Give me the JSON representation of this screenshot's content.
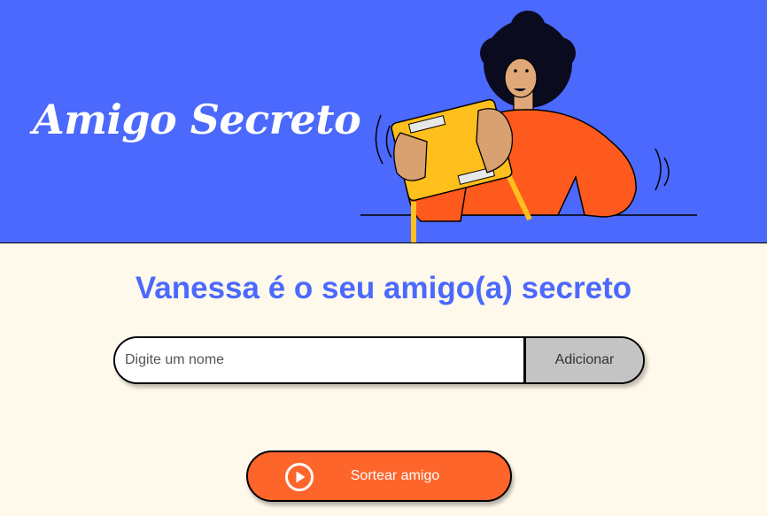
{
  "header": {
    "title": "Amigo Secreto",
    "illustration_icon": "person-holding-gift-illustration",
    "background_color": "#4b69fd"
  },
  "result": {
    "text": "Vanessa é o seu amigo(a) secreto",
    "color": "#4b69fd"
  },
  "form": {
    "input_value": "",
    "input_placeholder": "Digite um nome",
    "add_label": "Adicionar",
    "add_button_color": "#c4c4c4"
  },
  "draw": {
    "label": "Sortear amigo",
    "icon": "play-circle-icon",
    "color": "#fe652b"
  },
  "page": {
    "background_color": "#fff9eb"
  }
}
